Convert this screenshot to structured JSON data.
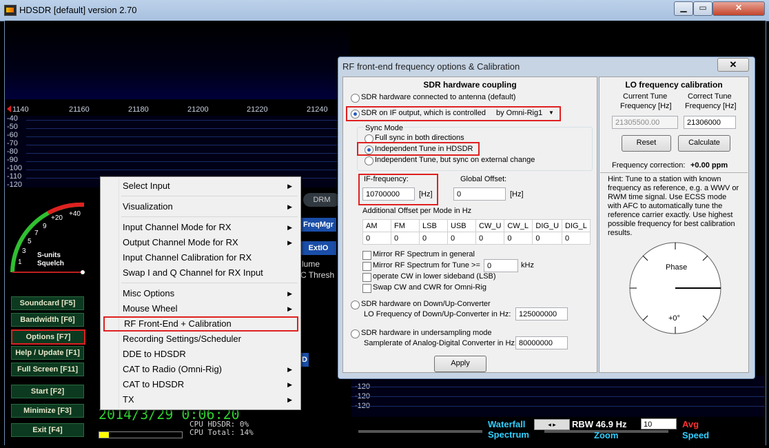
{
  "window": {
    "title": "HDSDR [default]  version 2.70",
    "min": "▁",
    "max": "▭",
    "close": "✕"
  },
  "freq_axis": [
    "1140",
    "21160",
    "21180",
    "21200",
    "21220",
    "21240"
  ],
  "db_labels": [
    "-40",
    "-50",
    "-60",
    "-70",
    "-80",
    "-90",
    "-100",
    "-110",
    "-120"
  ],
  "smeter": {
    "label1": "S-units",
    "label2": "Squelch",
    "scale": [
      "1",
      "3",
      "5",
      "7",
      "9",
      "+20",
      "+40"
    ]
  },
  "left_buttons": [
    {
      "label": "Soundcard   [F5]"
    },
    {
      "label": "Bandwidth   [F6]"
    },
    {
      "label": "Options     [F7]"
    },
    {
      "label": "Help / Update  [F1]"
    },
    {
      "label": "Full Screen  [F11]"
    },
    {
      "label": "Start        [F2]"
    },
    {
      "label": "Minimize     [F3]"
    },
    {
      "label": "Exit         [F4]"
    }
  ],
  "clock": "2014/3/29 0:06:20",
  "cpu": {
    "hdsdr": "CPU HDSDR: 0%",
    "total": "CPU Total: 14%"
  },
  "behind": {
    "drm": "DRM",
    "freqmgr": "FreqMgr",
    "extio": "ExtIO",
    "volume": "lume",
    "thresh": "C Thresh",
    "d": "D"
  },
  "menu": {
    "items": [
      {
        "label": "Select Input",
        "sub": true
      },
      {
        "label": "Visualization",
        "sub": true
      },
      {
        "label": "Input Channel Mode for RX",
        "sub": true
      },
      {
        "label": "Output Channel Mode for RX",
        "sub": true
      },
      {
        "label": "Input Channel Calibration for RX",
        "sub": false
      },
      {
        "label": "Swap I and Q Channel for RX Input",
        "sub": false
      },
      {
        "label": "Misc Options",
        "sub": true
      },
      {
        "label": "Mouse Wheel",
        "sub": true
      },
      {
        "label": "RF Front-End + Calibration",
        "sub": false
      },
      {
        "label": "Recording Settings/Scheduler",
        "sub": false
      },
      {
        "label": "DDE to HDSDR",
        "sub": false
      },
      {
        "label": "CAT to Radio (Omni-Rig)",
        "sub": true
      },
      {
        "label": "CAT to HDSDR",
        "sub": true
      },
      {
        "label": "TX",
        "sub": true
      }
    ],
    "arrow": "▶"
  },
  "dialog": {
    "title": "RF front-end frequency options & Calibration",
    "close": "✕",
    "hw": {
      "title": "SDR hardware coupling",
      "opt_antenna": "SDR hardware connected to antenna (default)",
      "opt_if": "SDR on IF output, which is controlled",
      "if_select": "by Omni-Rig1",
      "sync_title": "Sync Mode",
      "sync_full": "Full sync in both directions",
      "sync_indep": "Independent Tune in HDSDR",
      "sync_ext": "Independent Tune, but sync on external change",
      "if_freq_label": "IF-frequency:",
      "if_freq_value": "10700000",
      "hz": "[Hz]",
      "global_offset_label": "Global Offset:",
      "global_offset_value": "0",
      "add_offset_label": "Additional Offset per Mode in Hz",
      "modes": [
        "AM",
        "FM",
        "LSB",
        "USB",
        "CW_U",
        "CW_L",
        "DIG_U",
        "DIG_L"
      ],
      "mode_values": [
        "0",
        "0",
        "0",
        "0",
        "0",
        "0",
        "0",
        "0"
      ],
      "mirror_general": "Mirror RF Spectrum in general",
      "mirror_tune": "Mirror RF Spectrum for Tune >=",
      "mirror_tune_value": "0",
      "khz": "kHz",
      "cw_lsb": "operate CW in lower sideband (LSB)",
      "swap_cw": "Swap CW and CWR for Omni-Rig",
      "opt_conv": "SDR hardware on Down/Up-Converter",
      "lo_label": "LO Frequency of Down/Up-Converter in Hz:",
      "lo_value": "125000000",
      "opt_under": "SDR hardware in undersampling mode",
      "sr_label": "Samplerate of Analog-Digital Converter in Hz:",
      "sr_value": "80000000",
      "apply": "Apply"
    },
    "lo": {
      "title": "LO frequency calibration",
      "cur_label1": "Current Tune",
      "cur_label2": "Frequency [Hz]",
      "cor_label1": "Correct Tune",
      "cor_label2": "Frequency [Hz]",
      "cur_value": "21305500.00",
      "cor_value": "21306000",
      "reset": "Reset",
      "calculate": "Calculate",
      "corr_label": "Frequency correction:",
      "corr_value": "+0.00 ppm",
      "hint": "Hint: Tune to a station with known frequency as reference, e.g. a WWV or RWM time signal. Use ECSS mode with AFC to automatically tune the reference carrier exactly. Use highest possible frequency for best calibration results.",
      "phase_label": "Phase",
      "phase_value": "+0°"
    }
  },
  "bottom": {
    "waterfall": "Waterfall",
    "spectrum": "Spectrum",
    "rbw": "RBW 46.9 Hz",
    "avg_value": "10",
    "avg": "Avg",
    "zoom": "Zoom",
    "speed": "Speed",
    "db_labels": [
      "-120",
      "-120",
      "-120"
    ]
  }
}
